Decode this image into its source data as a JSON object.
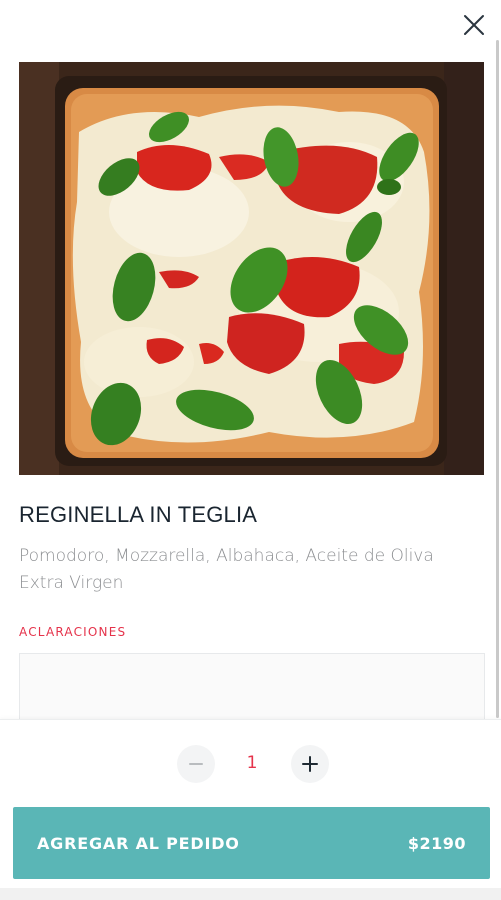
{
  "modal": {
    "close_icon": "close-icon",
    "image_alt": "Reginella in teglia pizza"
  },
  "product": {
    "title": "REGINELLA IN TEGLIA",
    "description": "Pomodoro, Mozzarella, Albahaca, Aceite de Oliva Extra Virgen"
  },
  "notes": {
    "label": "ACLARACIONES",
    "value": "",
    "placeholder": ""
  },
  "quantity": {
    "value": "1",
    "minus_icon": "minus-icon",
    "plus_icon": "plus-icon"
  },
  "add_button": {
    "label": "AGREGAR AL PEDIDO",
    "price": "$2190"
  },
  "colors": {
    "accent": "#5ab6b6",
    "highlight": "#e5334b",
    "title": "#1a2530",
    "description": "#8d8f92"
  }
}
